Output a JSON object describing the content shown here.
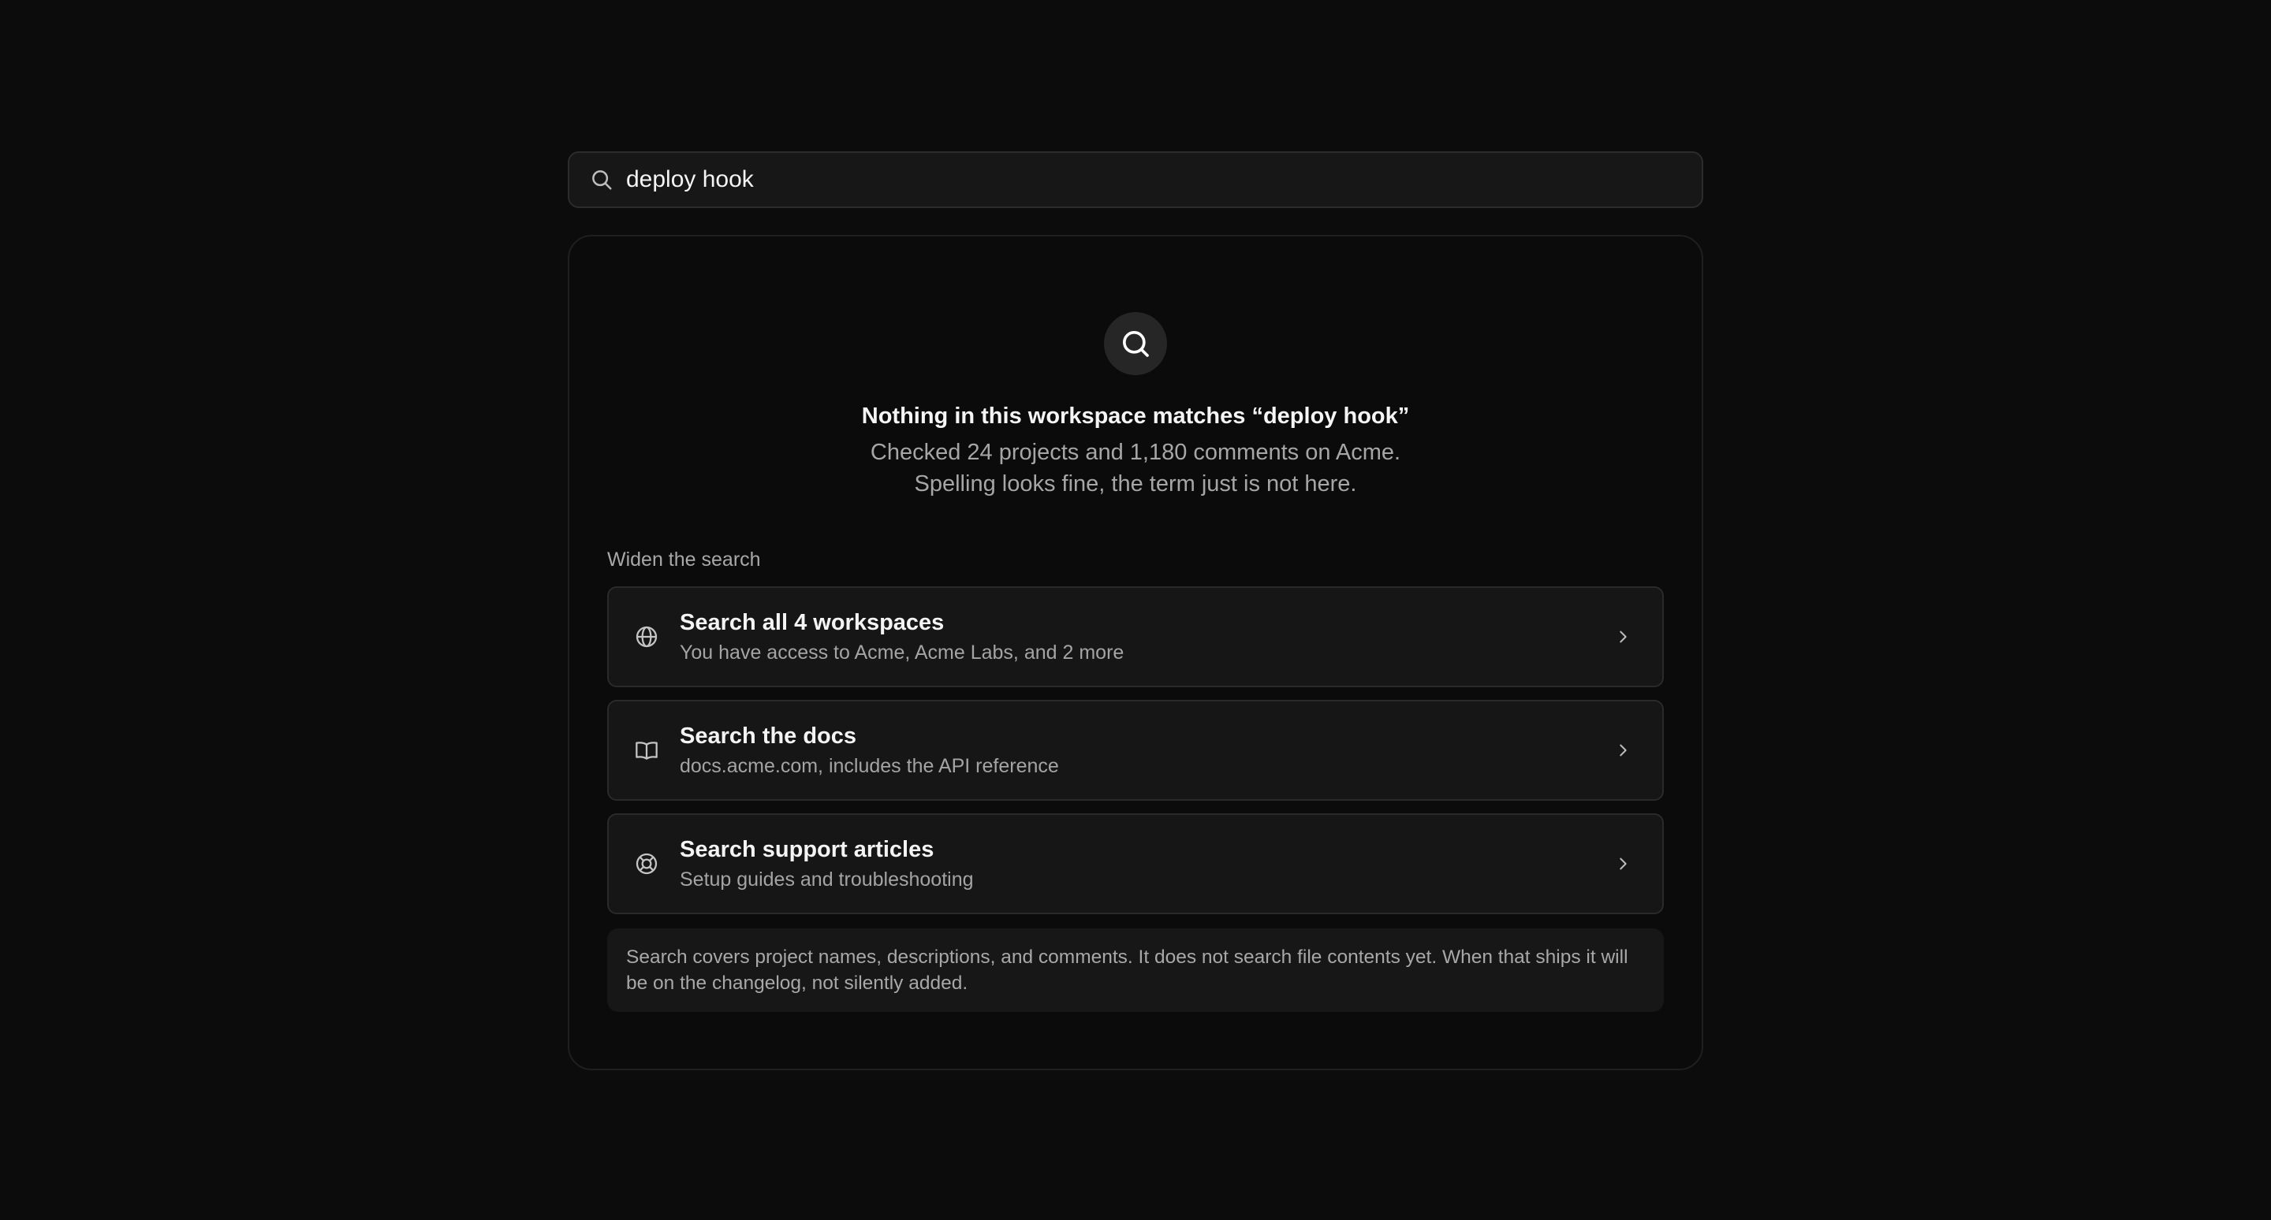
{
  "search": {
    "value": "deploy hook",
    "icon": "search-icon"
  },
  "empty_state": {
    "icon": "search-icon",
    "title": "Nothing in this workspace matches “deploy hook”",
    "desc_line1": "Checked 24 projects and 1,180 comments on Acme.",
    "desc_line2": "Spelling looks fine, the term just is not here."
  },
  "widen": {
    "label": "Widen the search",
    "options": [
      {
        "icon": "globe-icon",
        "title": "Search all 4 workspaces",
        "subtitle": "You have access to Acme, Acme Labs, and 2 more"
      },
      {
        "icon": "book-icon",
        "title": "Search the docs",
        "subtitle": "docs.acme.com, includes the API reference"
      },
      {
        "icon": "lifebuoy-icon",
        "title": "Search support articles",
        "subtitle": "Setup guides and troubleshooting"
      }
    ]
  },
  "note": "Search covers project names, descriptions, and comments. It does not search file contents yet. When that ships it will be on the changelog, not silently added.",
  "colors": {
    "background": "#0c0c0c",
    "panel": "#0b0b0b",
    "card": "#161616",
    "text_primary": "#f4f4f4",
    "text_secondary": "#a6a6a6"
  }
}
